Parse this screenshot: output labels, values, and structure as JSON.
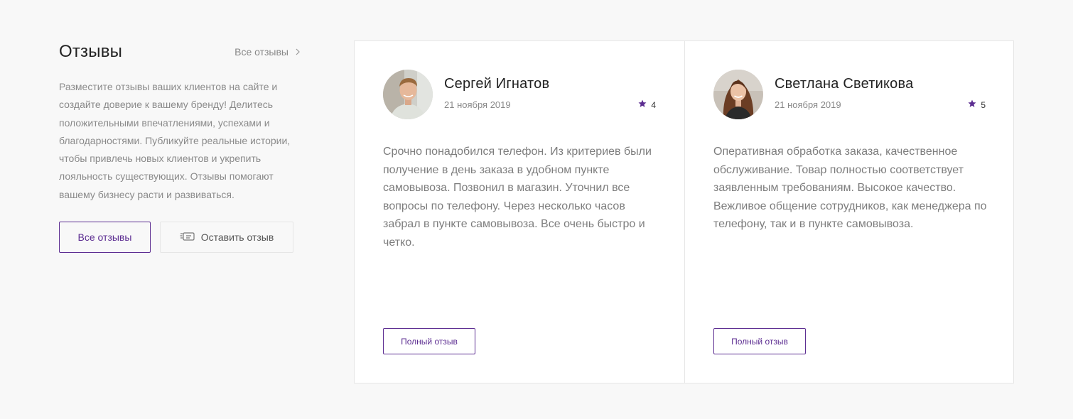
{
  "intro": {
    "title": "Отзывы",
    "all_link": "Все отзывы",
    "description": "Разместите отзывы ваших клиентов на сайте и создайте доверие к вашему бренду! Делитесь положительными впечатлениями, успехами и благодарностями. Публикуйте реальные истории, чтобы привлечь новых клиентов и укрепить лояльность существующих. Отзывы помогают вашему бизнесу расти и развиваться.",
    "all_button": "Все отзывы",
    "leave_button": "Оставить отзыв"
  },
  "reviews": [
    {
      "name": "Сергей Игнатов",
      "date": "21 ноября 2019",
      "rating": "4",
      "text": "Срочно понадобился телефон. Из критериев были получение в день заказа в удобном пункте самовывоза. Позвонил в магазин. Уточнил все вопросы по телефону. Через несколько часов забрал в пункте самовывоза. Все очень быстро и четко.",
      "button": "Полный отзыв"
    },
    {
      "name": "Светлана Светикова",
      "date": "21 ноября 2019",
      "rating": "5",
      "text": "Оперативная обработка заказа, качественное обслуживание. Товар полностью соответствует заявленным требованиям. Высокое качество. Вежливое общение сотрудников, как менеджера по телефону, так и в пункте самовывоза.",
      "button": "Полный отзыв"
    }
  ],
  "colors": {
    "accent": "#5c2d91",
    "star": "#5c2d91",
    "text_muted": "#7d7d7d",
    "border": "#e6e6e6",
    "background": "#f8f8f8"
  },
  "icons": {
    "all_link": "chevron-right-icon",
    "leave_button": "review-box-icon",
    "rating": "star-icon"
  }
}
